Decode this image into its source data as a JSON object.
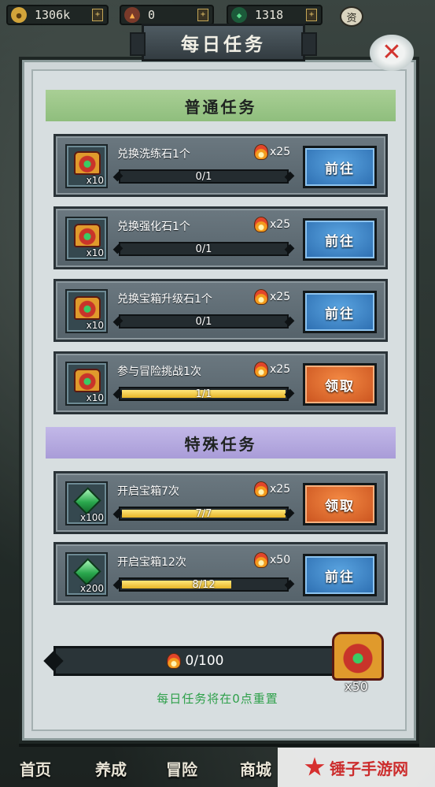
{
  "resources": {
    "coins": "1306k",
    "fire": "0",
    "gems": "1318",
    "badge": "资"
  },
  "dialog": {
    "title": "每日任务",
    "close_icon": "close-icon"
  },
  "sections": {
    "normal_title": "普通任务",
    "special_title": "特殊任务"
  },
  "tasks": [
    {
      "name": "兑换洗练石1个",
      "item": "chest",
      "item_qty": "x10",
      "reward": "x25",
      "progress": "0/1",
      "fraction": 0.0,
      "button": "前往",
      "button_type": "go"
    },
    {
      "name": "兑换强化石1个",
      "item": "chest",
      "item_qty": "x10",
      "reward": "x25",
      "progress": "0/1",
      "fraction": 0.0,
      "button": "前往",
      "button_type": "go"
    },
    {
      "name": "兑换宝箱升级石1个",
      "item": "chest",
      "item_qty": "x10",
      "reward": "x25",
      "progress": "0/1",
      "fraction": 0.0,
      "button": "前往",
      "button_type": "go"
    },
    {
      "name": "参与冒险挑战1次",
      "item": "chest",
      "item_qty": "x10",
      "reward": "x25",
      "progress": "1/1",
      "fraction": 1.0,
      "button": "领取",
      "button_type": "claim"
    },
    {
      "name": "开启宝箱7次",
      "item": "gem",
      "item_qty": "x100",
      "reward": "x25",
      "progress": "7/7",
      "fraction": 1.0,
      "button": "领取",
      "button_type": "claim"
    },
    {
      "name": "开启宝箱12次",
      "item": "gem",
      "item_qty": "x200",
      "reward": "x50",
      "progress": "8/12",
      "fraction": 0.6667,
      "button": "前往",
      "button_type": "go"
    }
  ],
  "total": {
    "progress": "0/100",
    "chest_qty": "x50",
    "reset_note": "每日任务将在0点重置"
  },
  "nav": {
    "home": "首页",
    "train": "养成",
    "adventure": "冒险",
    "shop": "商城"
  },
  "watermark": "锤子手游网",
  "colors": {
    "go_button": "#2c6db0",
    "claim_button": "#c9521e",
    "normal_header": "#a9cf95",
    "special_header": "#a99cd8",
    "progress_fill": "#e6b528"
  }
}
